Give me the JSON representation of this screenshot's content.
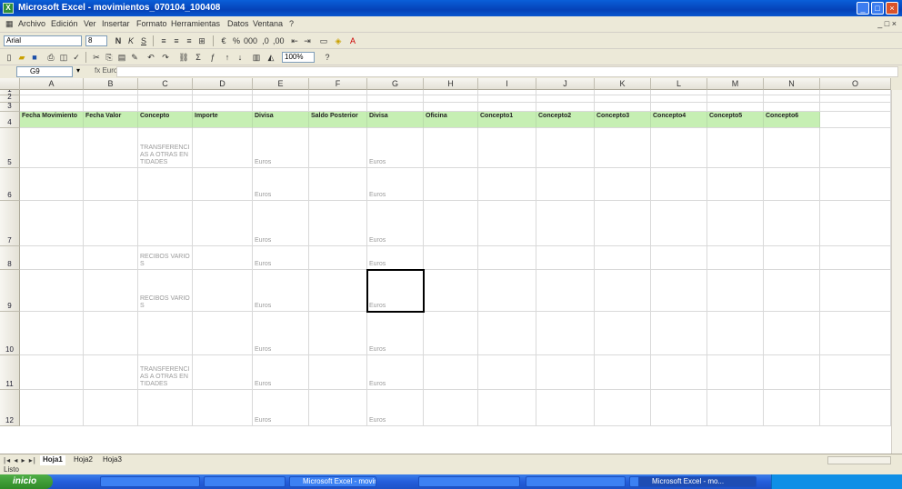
{
  "app": {
    "title": "Microsoft Excel - movimientos_070104_100408"
  },
  "menu": [
    "Archivo",
    "Edición",
    "Ver",
    "Insertar",
    "Formato",
    "Herramientas",
    "Datos",
    "Ventana",
    "?"
  ],
  "toolbar": {
    "font": "Arial",
    "size": "8",
    "zoom": "100%"
  },
  "formula_bar": {
    "name_box": "G9",
    "fx": "fx Euros",
    "content": ""
  },
  "columns": [
    "A",
    "B",
    "C",
    "D",
    "E",
    "F",
    "G",
    "H",
    "I",
    "J",
    "K",
    "L",
    "M",
    "N",
    "O"
  ],
  "rows": [
    "1",
    "2",
    "3",
    "4",
    "5",
    "6",
    "7",
    "8",
    "9",
    "10",
    "11",
    "12"
  ],
  "note_row2": "",
  "header_row": [
    "Fecha Movimiento",
    "Fecha Valor",
    "Concepto",
    "Importe",
    "Divisa",
    "Saldo Posterior",
    "Divisa",
    "Oficina",
    "Concepto1",
    "Concepto2",
    "Concepto3",
    "Concepto4",
    "Concepto5",
    "Concepto6"
  ],
  "data_rows": [
    [
      "",
      "",
      "TRANSFERENCIAS A OTRAS ENTIDADES",
      "",
      "Euros",
      "",
      "Euros",
      "",
      "",
      "",
      "",
      "",
      "",
      ""
    ],
    [
      "",
      "",
      "",
      "",
      "Euros",
      "",
      "Euros",
      "",
      "",
      "",
      "",
      "",
      "",
      ""
    ],
    [
      "",
      "",
      "",
      "",
      "Euros",
      "",
      "Euros",
      "",
      "",
      "",
      "",
      "",
      "",
      ""
    ],
    [
      "",
      "",
      "RECIBOS VARIOS",
      "",
      "Euros",
      "",
      "Euros",
      "",
      "",
      "",
      "",
      "",
      "",
      ""
    ],
    [
      "",
      "",
      "RECIBOS VARIOS",
      "",
      "Euros",
      "",
      "Euros",
      "",
      "",
      "",
      "",
      "",
      "",
      ""
    ],
    [
      "",
      "",
      "",
      "",
      "Euros",
      "",
      "Euros",
      "",
      "",
      "",
      "",
      "",
      "",
      ""
    ],
    [
      "",
      "",
      "TRANSFERENCIAS A OTRAS ENTIDADES",
      "",
      "Euros",
      "",
      "Euros",
      "",
      "",
      "",
      "",
      "",
      "",
      ""
    ],
    [
      "",
      "",
      "",
      "",
      "Euros",
      "",
      "Euros",
      "",
      "",
      "",
      "",
      "",
      "",
      ""
    ]
  ],
  "sheet_tabs": [
    "Hoja1",
    "Hoja2",
    "Hoja3"
  ],
  "status": "Listo",
  "taskbar": {
    "start": "inicio",
    "tasks": [
      "",
      "",
      "Microsoft Excel - movimientos",
      "",
      "",
      "",
      "Microsoft Excel - mo..."
    ],
    "clock": ""
  },
  "colors": {
    "header_fill": "#c6efb3",
    "title_blue": "#0542b8"
  }
}
